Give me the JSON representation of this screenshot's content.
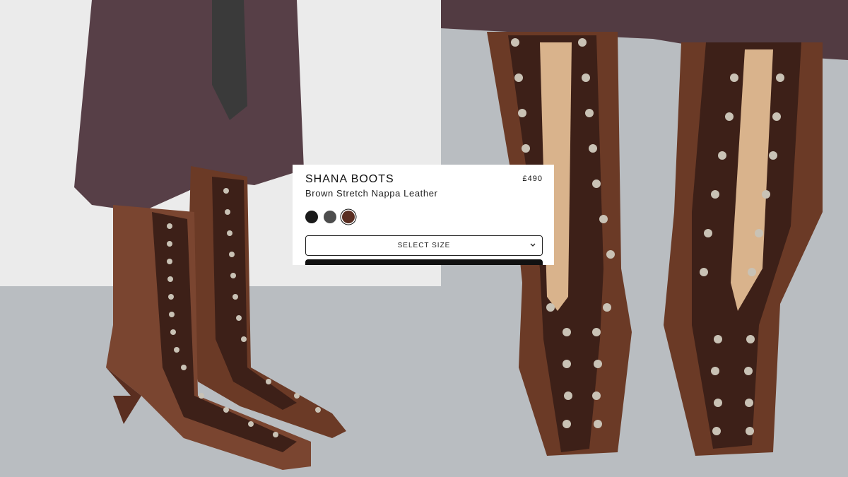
{
  "product": {
    "name": "SHANA BOOTS",
    "price": "£490",
    "subtitle": "Brown Stretch Nappa Leather"
  },
  "swatches": [
    {
      "name": "black",
      "color": "#1a1a1a",
      "selected": false
    },
    {
      "name": "grey",
      "color": "#4d4d4d",
      "selected": false
    },
    {
      "name": "brown",
      "color": "#5a2e22",
      "selected": true
    }
  ],
  "size_select": {
    "label": "SELECT SIZE",
    "icon": "chevron-down-icon"
  },
  "colors": {
    "card_bg": "#ffffff",
    "text": "#111111",
    "wall": "#ebebeb",
    "floor": "#b9bdc1",
    "leather_brown": "#6b3a26",
    "dress_plum": "#4a3038"
  }
}
